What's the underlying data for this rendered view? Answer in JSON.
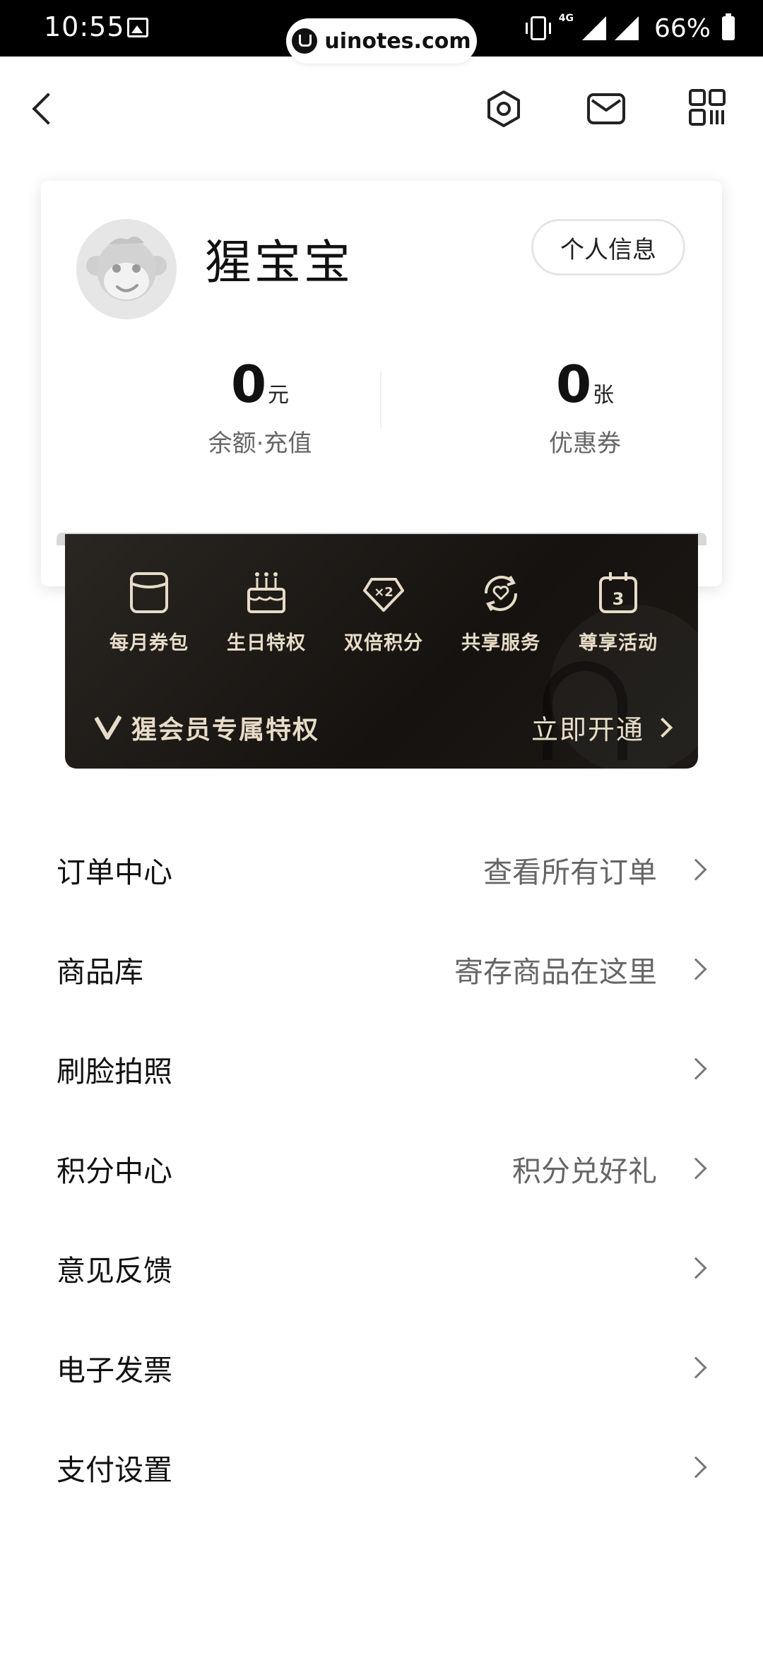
{
  "status_bar": {
    "time": "10:55",
    "network": "4G",
    "battery": "66%"
  },
  "watermark": {
    "text": "uinotes.com"
  },
  "nav": {
    "icons": [
      "back-icon",
      "settings-icon",
      "mail-icon",
      "qr-code-icon"
    ]
  },
  "profile": {
    "username": "猩宝宝",
    "info_button": "个人信息",
    "balance_value": "0",
    "balance_unit": "元",
    "balance_label": "余额·充值",
    "coupon_value": "0",
    "coupon_unit": "张",
    "coupon_label": "优惠券"
  },
  "vip": {
    "perks": [
      {
        "label": "每月券包",
        "icon": "coupon-pack-icon"
      },
      {
        "label": "生日特权",
        "icon": "birthday-cake-icon"
      },
      {
        "label": "双倍积分",
        "icon": "double-points-icon"
      },
      {
        "label": "共享服务",
        "icon": "shared-service-icon"
      },
      {
        "label": "尊享活动",
        "icon": "calendar-icon"
      }
    ],
    "title": "猩会员专属特权",
    "open_label": "立即开通"
  },
  "menu": [
    {
      "label": "订单中心",
      "hint": "查看所有订单"
    },
    {
      "label": "商品库",
      "hint": "寄存商品在这里"
    },
    {
      "label": "刷脸拍照",
      "hint": ""
    },
    {
      "label": "积分中心",
      "hint": "积分兑好礼"
    },
    {
      "label": "意见反馈",
      "hint": ""
    },
    {
      "label": "电子发票",
      "hint": ""
    },
    {
      "label": "支付设置",
      "hint": ""
    }
  ],
  "colors": {
    "vip_gold": "#e8dcc8",
    "vip_bg": "#15120f",
    "text_primary": "#111111",
    "text_secondary": "#666666"
  }
}
